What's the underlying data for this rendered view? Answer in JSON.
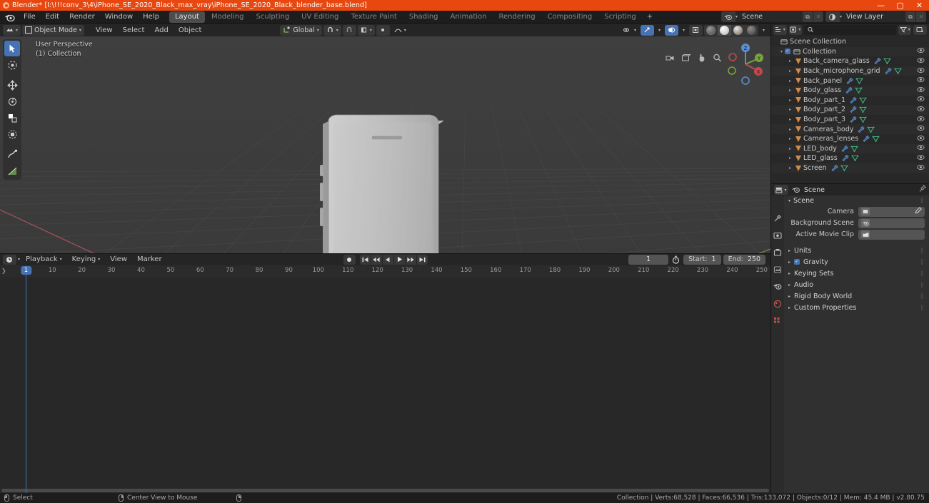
{
  "window": {
    "title": "Blender* [I:\\!!!conv_3\\4\\iPhone_SE_2020_Black_max_vray\\iPhone_SE_2020_Black_blender_base.blend]",
    "minimize": "—",
    "maximize": "▢",
    "close": "✕",
    "titlebar_color": "#e8480f"
  },
  "menubar": {
    "logo": "blender-logo-icon",
    "items": [
      "File",
      "Edit",
      "Render",
      "Window",
      "Help"
    ],
    "workspaces": [
      {
        "label": "Layout",
        "active": true
      },
      {
        "label": "Modeling",
        "active": false
      },
      {
        "label": "Sculpting",
        "active": false
      },
      {
        "label": "UV Editing",
        "active": false
      },
      {
        "label": "Texture Paint",
        "active": false
      },
      {
        "label": "Shading",
        "active": false
      },
      {
        "label": "Animation",
        "active": false
      },
      {
        "label": "Rendering",
        "active": false
      },
      {
        "label": "Compositing",
        "active": false
      },
      {
        "label": "Scripting",
        "active": false
      }
    ],
    "add_workspace": "+",
    "scene_selector": {
      "label": "Scene",
      "new_btn": "⧉",
      "unlink_btn": "✕"
    },
    "viewlayer_selector": {
      "label": "View Layer",
      "new_btn": "⧉",
      "unlink_btn": "✕"
    }
  },
  "viewport_header": {
    "editor_type": "editor-type-icon",
    "mode": "Object Mode",
    "menus": [
      "View",
      "Select",
      "Add",
      "Object"
    ],
    "transform_orientation": "Global",
    "snap_icon": "magnet-icon",
    "proportional_icon": "proportional-edit-icon",
    "overlays_dropdown": "▾"
  },
  "viewport": {
    "perspective_label": "User Perspective",
    "collection_label": "(1) Collection",
    "gizmo_axes": {
      "x": "X",
      "y": "Y",
      "z": "Z"
    },
    "background_top": "#3e3e3e",
    "background_bottom": "#393939",
    "grid_color": "#4b4b4b",
    "axis_x_color": "#b54a56",
    "axis_y_color": "#7a9c3e",
    "object_color": "#b0b0b0",
    "tools": [
      {
        "name": "tweak-tool",
        "active": true
      },
      {
        "name": "select-box-tool",
        "active": false
      },
      {
        "name": "move-tool",
        "active": false
      },
      {
        "name": "rotate-tool",
        "active": false
      },
      {
        "name": "scale-tool",
        "active": false
      },
      {
        "name": "transform-tool",
        "active": false
      },
      {
        "name": "annotate-tool",
        "active": false
      },
      {
        "name": "measure-tool",
        "active": false
      }
    ]
  },
  "outliner": {
    "display_mode": "View Layer",
    "search_placeholder": "",
    "filter_icon": "filter-icon",
    "root": "Scene Collection",
    "collection": {
      "label": "Collection",
      "checked": true
    },
    "objects": [
      {
        "name": "Back_camera_glass"
      },
      {
        "name": "Back_microphone_grid"
      },
      {
        "name": "Back_panel"
      },
      {
        "name": "Body_glass"
      },
      {
        "name": "Body_part_1"
      },
      {
        "name": "Body_part_2"
      },
      {
        "name": "Body_part_3"
      },
      {
        "name": "Cameras_body"
      },
      {
        "name": "Cameras_lenses"
      },
      {
        "name": "LED_body"
      },
      {
        "name": "LED_glass"
      },
      {
        "name": "Screen"
      }
    ]
  },
  "properties": {
    "breadcrumb": "Scene",
    "pin_icon": "pin-icon",
    "panel_title": "Scene",
    "rows": [
      {
        "label": "Camera",
        "value": "",
        "icon": "camera-icon",
        "has_picker": true
      },
      {
        "label": "Background Scene",
        "value": "",
        "icon": "scene-icon",
        "has_picker": false
      },
      {
        "label": "Active Movie Clip",
        "value": "",
        "icon": "clip-icon",
        "has_picker": false
      }
    ],
    "sections": [
      {
        "label": "Units",
        "checkbox": null
      },
      {
        "label": "Gravity",
        "checkbox": true
      },
      {
        "label": "Keying Sets",
        "checkbox": null
      },
      {
        "label": "Audio",
        "checkbox": null
      },
      {
        "label": "Rigid Body World",
        "checkbox": null
      },
      {
        "label": "Custom Properties",
        "checkbox": null
      }
    ],
    "tabs": [
      "tool-icon",
      "render-icon",
      "output-icon",
      "viewlayer-icon",
      "scene-icon",
      "world-icon",
      "object-icon"
    ]
  },
  "timeline": {
    "editor_icon": "timeline-editor-icon",
    "menus": [
      "Playback",
      "Keying",
      "View",
      "Marker"
    ],
    "transport": [
      "⏺",
      "⏮",
      "⏪",
      "◀",
      "▶",
      "⏩",
      "⏭"
    ],
    "current_frame": "1",
    "auto_key_icon": "stopwatch-icon",
    "start_label": "Start:",
    "start_value": "1",
    "end_label": "End:",
    "end_value": "250",
    "playhead_frame": "1",
    "ticks": [
      10,
      20,
      30,
      40,
      50,
      60,
      70,
      80,
      90,
      100,
      110,
      120,
      130,
      140,
      150,
      160,
      170,
      180,
      190,
      200,
      210,
      220,
      230,
      240,
      250
    ]
  },
  "statusbar": {
    "left": [
      {
        "mouse": "left-click",
        "label": "Select"
      },
      {
        "mouse": "middle-click",
        "label": "Center View to Mouse"
      },
      {
        "mouse": "right-click",
        "label": ""
      }
    ],
    "stats": "Collection | Verts:68,528 | Faces:66,536 | Tris:133,072 | Objects:0/12 | Mem: 45.4 MB | v2.80.75"
  }
}
